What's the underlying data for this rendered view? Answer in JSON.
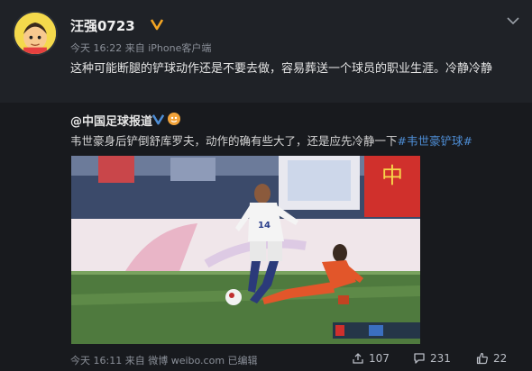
{
  "post": {
    "username": "汪强0723",
    "time": "今天 16:22",
    "from_label": "来自",
    "source": "iPhone客户端",
    "text": "这种可能断腿的铲球动作还是不要去做，容易葬送一个球员的职业生涯。冷静冷静"
  },
  "repost": {
    "username": "@中国足球报道",
    "text_main": "韦世豪身后铲倒舒库罗夫，动作的确有些大了，还是应先冷静一下",
    "hashtag": "#韦世豪铲球#",
    "time": "今天 16:11",
    "from_label": "来自",
    "source": "微博 weibo.com",
    "edited": "已编辑",
    "share_count": "107",
    "comment_count": "231",
    "like_count": "22"
  },
  "video": {
    "jersey_number": "14",
    "banner_text": "中"
  },
  "colors": {
    "background": "#1e2126",
    "link_blue": "#4e8ed6",
    "verified_gold": "#f5a623"
  },
  "icons": [
    "avatar",
    "verified-icon",
    "chevron-down-icon",
    "share-icon",
    "comment-icon",
    "like-icon"
  ]
}
